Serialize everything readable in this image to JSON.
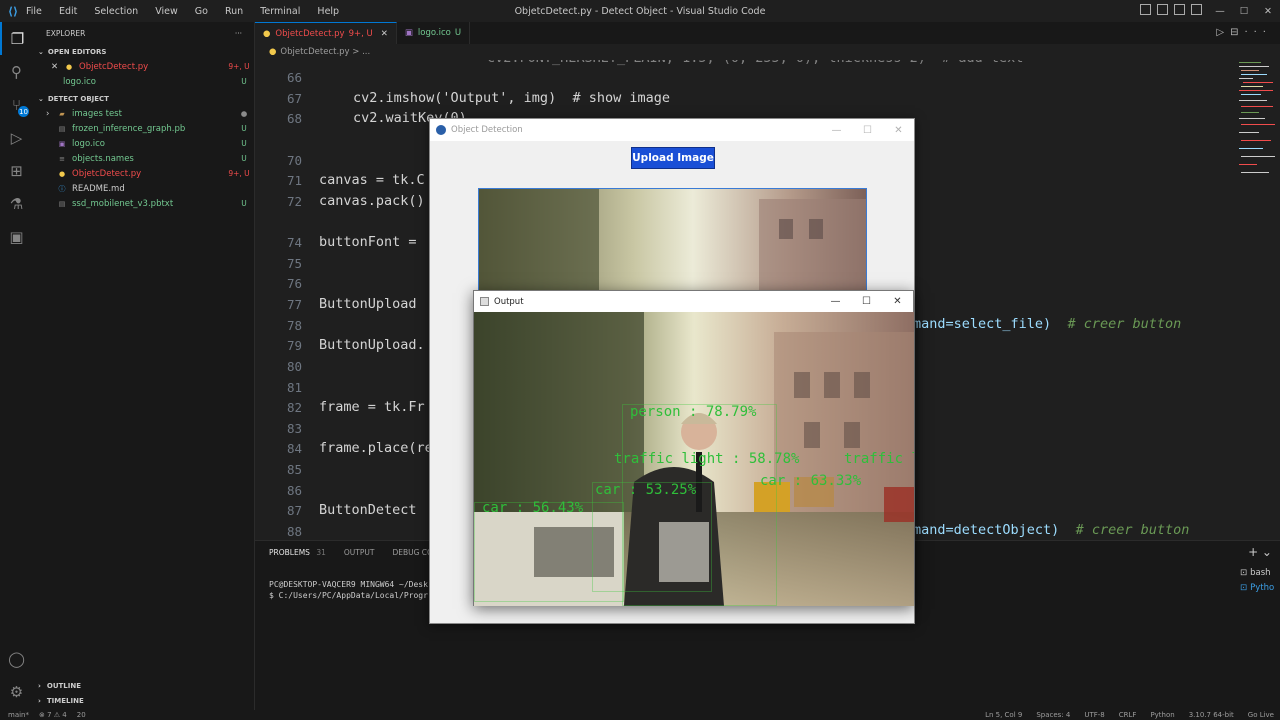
{
  "titlebar": {
    "menu": [
      "File",
      "Edit",
      "Selection",
      "View",
      "Go",
      "Run",
      "Terminal",
      "Help"
    ],
    "title": "ObjetcDetect.py - Detect Object - Visual Studio Code"
  },
  "activitybar": {
    "scm_badge": "10"
  },
  "sidebar": {
    "header": "EXPLORER",
    "open_editors_label": "OPEN EDITORS",
    "open_editors": [
      {
        "label": "ObjetcDetect.py",
        "status": "9+, U",
        "icon": "python-icon"
      },
      {
        "label": "logo.ico",
        "status": "U",
        "icon": "image-icon"
      }
    ],
    "folder_label": "DETECT OBJECT",
    "files": [
      {
        "label": "images test",
        "status": "",
        "icon": "folder-icon"
      },
      {
        "label": "frozen_inference_graph.pb",
        "status": "U",
        "icon": "file-icon"
      },
      {
        "label": "logo.ico",
        "status": "U",
        "icon": "image-icon"
      },
      {
        "label": "objects.names",
        "status": "U",
        "icon": "file-icon"
      },
      {
        "label": "ObjetcDetect.py",
        "status": "9+, U",
        "icon": "python-icon"
      },
      {
        "label": "README.md",
        "status": "",
        "icon": "info-icon"
      },
      {
        "label": "ssd_mobilenet_v3.pbtxt",
        "status": "U",
        "icon": "file-icon"
      }
    ],
    "outline_label": "OUTLINE",
    "timeline_label": "TIMELINE"
  },
  "tabs": [
    {
      "label": "ObjetcDetect.py",
      "status": "9+, U"
    },
    {
      "label": "logo.ico",
      "status": "U"
    }
  ],
  "breadcrumb": "ObjetcDetect.py > ...",
  "editor": {
    "lines": [
      {
        "num": "66",
        "code": ""
      },
      {
        "num": "67",
        "code": "cv2.imshow('Output', img)  # show image"
      },
      {
        "num": "68",
        "code": "cv2.waitKey(0)"
      },
      {
        "num": "70",
        "code": ""
      },
      {
        "num": "71",
        "code": "canvas = tk.C"
      },
      {
        "num": "72",
        "code": "canvas.pack()"
      },
      {
        "num": "74",
        "code": "buttonFont = "
      },
      {
        "num": "75",
        "code": ""
      },
      {
        "num": "76",
        "code": ""
      },
      {
        "num": "77",
        "code": "ButtonUpload "
      },
      {
        "num": "78",
        "code": ""
      },
      {
        "num": "79",
        "code": "ButtonUpload."
      },
      {
        "num": "80",
        "code": ""
      },
      {
        "num": "81",
        "code": ""
      },
      {
        "num": "82",
        "code": "frame = tk.Fr"
      },
      {
        "num": "83",
        "code": ""
      },
      {
        "num": "84",
        "code": "frame.place(re"
      },
      {
        "num": "85",
        "code": ""
      },
      {
        "num": "86",
        "code": ""
      },
      {
        "num": "87",
        "code": ""
      },
      {
        "num": "88",
        "code": "ButtonDetect "
      }
    ],
    "right_fragment_1": "mand=select_file)",
    "right_comment_1": "# creer button",
    "right_fragment_2": "mand=detectObject)",
    "right_comment_2": "# creer button"
  },
  "panel": {
    "tabs": [
      "PROBLEMS",
      "OUTPUT",
      "DEBUG CON"
    ],
    "problems_count": "31",
    "terminal": [
      "PC@DESKTOP-VAQCER9 MINGW64 ~/Desk",
      "$ C:/Users/PC/AppData/Local/Progr"
    ],
    "side": [
      "bash",
      "Pytho"
    ]
  },
  "statusbar": {
    "left": [
      "main*",
      "⊗ 7 ⚠ 4",
      "20"
    ],
    "right": [
      "Ln 5, Col 9",
      "Spaces: 4",
      "UTF-8",
      "CRLF",
      "Python",
      "3.10.7 64-bit",
      "Go Live"
    ]
  },
  "od_window": {
    "title": "Object Detection",
    "upload_label": "Upload Image"
  },
  "out_window": {
    "title": "Output",
    "detections": [
      {
        "label": "person : 78.79%"
      },
      {
        "label": "traffic light : 58.78%"
      },
      {
        "label": "car : 53.25%"
      },
      {
        "label": "car : 56.43%"
      },
      {
        "label": "car : 63.33%"
      },
      {
        "label": "traffic light"
      }
    ]
  }
}
